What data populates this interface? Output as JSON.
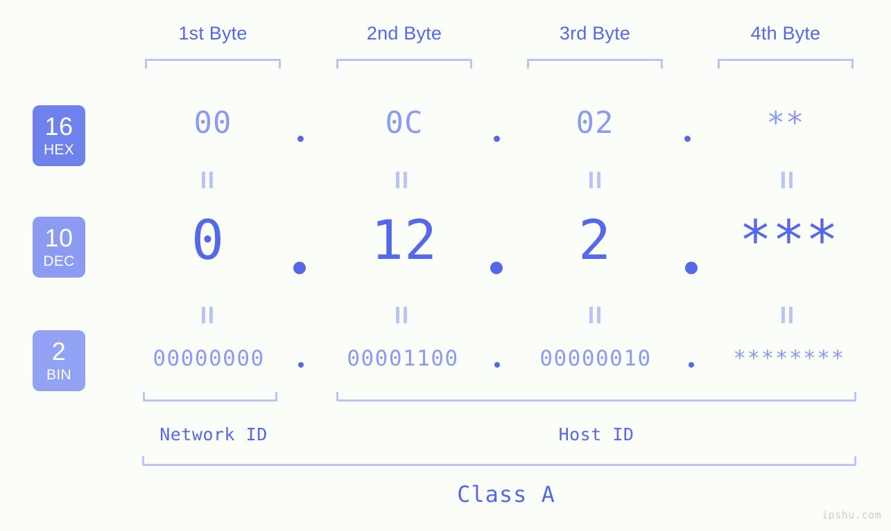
{
  "background": "#fbfdf9",
  "accent": "#5568e8",
  "accent_light": "#8c9bf2",
  "bracket_color": "#bcc4f7",
  "byte_headers": [
    {
      "label": "1st Byte"
    },
    {
      "label": "2nd Byte"
    },
    {
      "label": "3rd Byte"
    },
    {
      "label": "4th Byte"
    }
  ],
  "bases": [
    {
      "num": "16",
      "name": "HEX",
      "color": "#6f81ec"
    },
    {
      "num": "10",
      "name": "DEC",
      "color": "#8c9bf2"
    },
    {
      "num": "2",
      "name": "BIN",
      "color": "#92a2f5"
    }
  ],
  "rows": {
    "hex": {
      "values": [
        "00",
        "0C",
        "02",
        "**"
      ]
    },
    "dec": {
      "values": [
        "0",
        "12",
        "2",
        "***"
      ]
    },
    "bin": {
      "values": [
        "00000000",
        "00001100",
        "00000010",
        "********"
      ]
    }
  },
  "separator": ".",
  "equals_marker": "||",
  "segments": {
    "network_id": "Network ID",
    "host_id": "Host ID",
    "class": "Class A"
  },
  "watermark": "ipshu.com"
}
